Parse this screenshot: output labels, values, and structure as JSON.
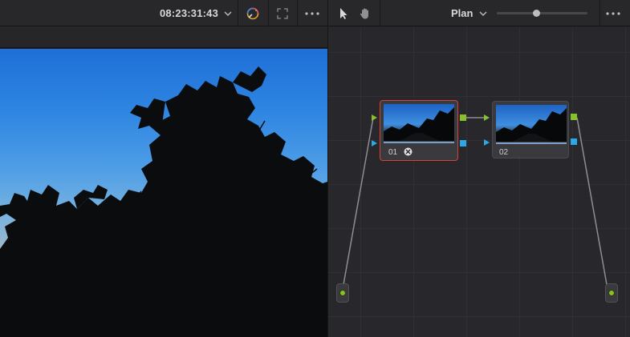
{
  "viewer": {
    "timecode": "08:23:31:43",
    "icons": [
      "chevron-down-icon",
      "color-picker-icon",
      "fullscreen-icon",
      "more-options-icon"
    ]
  },
  "node_editor": {
    "tools": [
      "pointer-icon",
      "hand-pan-icon"
    ],
    "mode_label": "Plan",
    "zoom_level": 0.44,
    "nodes": [
      {
        "label": "01",
        "selected": true,
        "has_badge": true
      },
      {
        "label": "02",
        "selected": false,
        "has_badge": false
      }
    ]
  },
  "colors": {
    "selected_border": "#d2443a",
    "output_port": "#86c02a",
    "key_port": "#29a9e8",
    "input_arrow": "#86c02a",
    "input_key_arrow": "#29a9e8"
  }
}
